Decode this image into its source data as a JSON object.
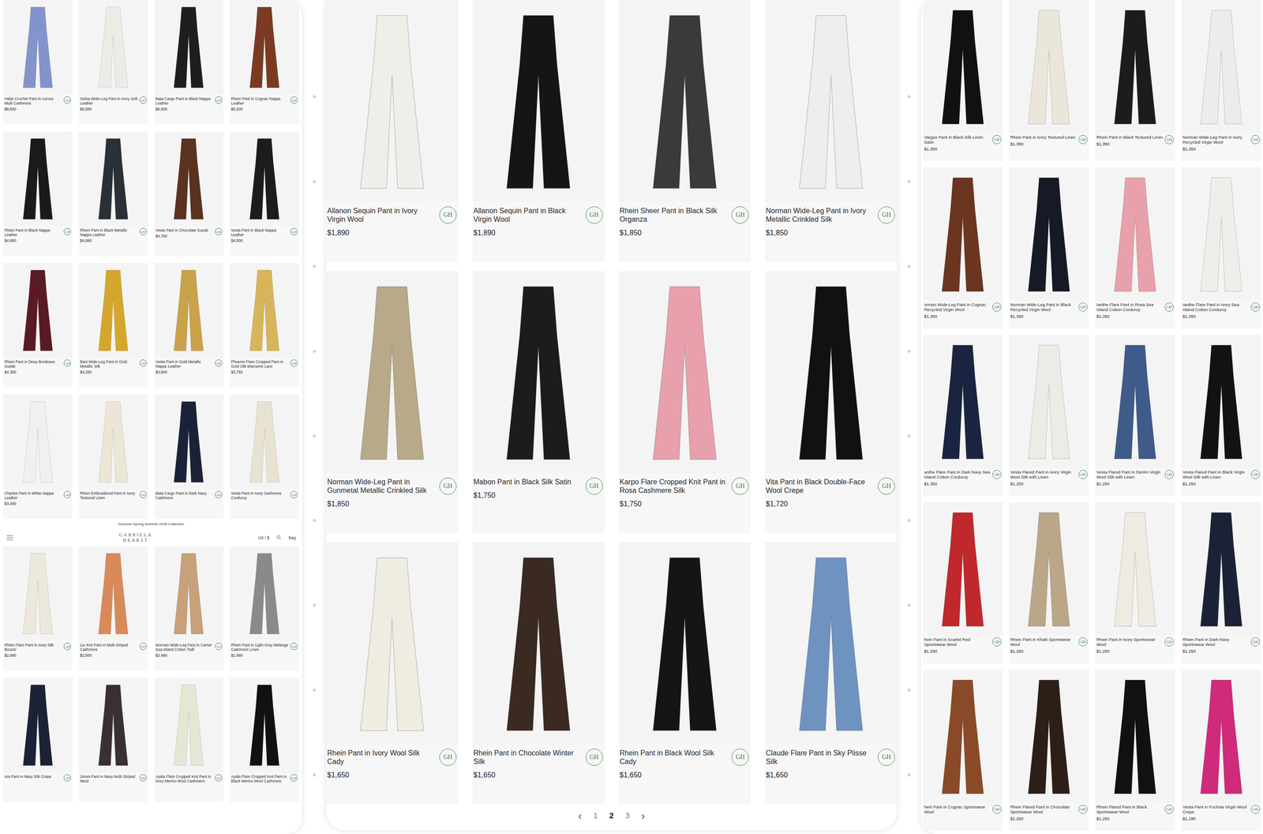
{
  "badge": "GH",
  "left_panel": {
    "products_top": [
      {
        "name": "Hebe Crochet Pant in Aurora Multi Cashmere",
        "price": "$8,600",
        "color": "#8394cc"
      },
      {
        "name": "Gelsa Wide-Leg Pant in Ivory Soft Leather",
        "price": "$6,990",
        "color": "#ecebe6"
      },
      {
        "name": "Bata Cargo Pant in Black Nappa Leather",
        "price": "$6,500",
        "color": "#1e1e1e"
      },
      {
        "name": "Rhein Pant in Cognac Nappa Leather",
        "price": "$5,200",
        "color": "#7a3b22"
      },
      {
        "name": "Rhein Pant in Black Nappa Leather",
        "price": "$4,990",
        "color": "#1a1a1a"
      },
      {
        "name": "Rhein Pant in Black Metallic Nappa Leather",
        "price": "$4,990",
        "color": "#2a3038"
      },
      {
        "name": "Vesta Pant in Chocolate Suede",
        "price": "$4,750",
        "color": "#5a3220"
      },
      {
        "name": "Vesta Pant in Black Nappa Leather",
        "price": "$4,500",
        "color": "#1c1c1c"
      },
      {
        "name": "Rhein Pant in Deep Bordeaux Suede",
        "price": "$4,350",
        "color": "#5a1a24"
      },
      {
        "name": "Bani Wide-Leg Pant in Gold Metallic Silk",
        "price": "$4,250",
        "color": "#d4a72c"
      },
      {
        "name": "Vesta Pant in Gold Metallic Nappa Leather",
        "price": "$3,900",
        "color": "#c9a24a"
      },
      {
        "name": "Phoenix Flare Cropped Pant in Gold Silk Macrame Lace",
        "price": "$3,750",
        "color": "#d8b45a"
      },
      {
        "name": "Charles Pant in White Nappa Leather",
        "price": "$3,490",
        "color": "#f0f0ee"
      },
      {
        "name": "Rhein Embroidered Pant in Ivory Textured Linen",
        "color": "#ece6d6"
      },
      {
        "name": "Bata Cargo Pant in Dark Navy Cashmere",
        "color": "#1b2238"
      },
      {
        "name": "Vesta Pant in Ivory Cashmere Corduroy",
        "color": "#e8e2d2"
      }
    ],
    "banner": "Discover Spring Summer 2026 Collection",
    "header": {
      "logo": "GABRIELA HEARST",
      "currency": "US / $",
      "bag": "Bag"
    },
    "products_bottom": [
      {
        "name": "Rhein Flare Pant in Ivory Silk Boucle",
        "price": "$2,990",
        "color": "#ece8dc"
      },
      {
        "name": "Liu Knit Pant in Multi Striped Cashmere",
        "price": "$2,500",
        "color": "#d98a5a"
      },
      {
        "name": "Norman Wide-Leg Pant in Camel Sea Island Cotton Twill",
        "price": "$2,490",
        "color": "#c8a07a"
      },
      {
        "name": "Rhein Pant in Light Grey Melange Cashmere Linen",
        "price": "$1,990",
        "color": "#8a8a8a"
      },
      {
        "name": "ura Pant in Navy Silk Crepe",
        "color": "#1c2236"
      },
      {
        "name": "Jones Pant in Navy Multi Striped Wool",
        "color": "#3a2f35"
      },
      {
        "name": "Ayala Flare Cropped Knit Pant in Ivory Merino Wool Cashmere",
        "color": "#e6e6d4"
      },
      {
        "name": "Ayala Flare Cropped Knit Pant in Black Merino Wool Cashmere",
        "color": "#111111"
      }
    ]
  },
  "middle_panel": {
    "products": [
      {
        "name": "Allanon Sequin Pant in Ivory Virgin Wool",
        "price": "$1,890",
        "color": "#efeee9"
      },
      {
        "name": "Allanon Sequin Pant in Black Virgin Wool",
        "price": "$1,890",
        "color": "#151515"
      },
      {
        "name": "Rhein Sheer Pant in Black Silk Organza",
        "price": "$1,850",
        "color": "#3a3a3a"
      },
      {
        "name": "Norman Wide-Leg Pant in Ivory Metallic Crinkled Silk",
        "price": "$1,850",
        "color": "#eeeeec"
      },
      {
        "name": "Norman Wide-Leg Pant in Gunmetal Metallic Crinkled Silk",
        "price": "$1,850",
        "color": "#b8aa88"
      },
      {
        "name": "Mabon Pant in Black Silk Satin",
        "price": "$1,750",
        "color": "#1c1c1c"
      },
      {
        "name": "Karpo Flare Cropped Knit Pant in Rosa Cashmere Silk",
        "price": "$1,750",
        "color": "#e8a0ac"
      },
      {
        "name": "Vita Pant in Black Double-Face Wool Crepe",
        "price": "$1,720",
        "color": "#111111"
      },
      {
        "name": "Rhein Pant in Ivory Wool Silk Cady",
        "price": "$1,650",
        "color": "#efece2"
      },
      {
        "name": "Rhein Pant in Chocolate Winter Silk",
        "price": "$1,650",
        "color": "#3a2a22"
      },
      {
        "name": "Rhein Pant in Black Wool Silk Cady",
        "price": "$1,650",
        "color": "#151515"
      },
      {
        "name": "Claude Flare Pant in Sky Plisse Silk",
        "price": "$1,650",
        "color": "#6f93c0"
      }
    ],
    "pagination": {
      "prev": "‹",
      "next": "›",
      "pages": [
        {
          "label": "1",
          "selected": false
        },
        {
          "label": "2",
          "selected": true
        },
        {
          "label": "3",
          "selected": false
        }
      ]
    }
  },
  "right_panel": {
    "products": [
      {
        "name": "Vargas Pant in Black Silk Linen Satin",
        "price": "$1,350",
        "color": "#111111"
      },
      {
        "name": "Rhein Pant in Ivory Textured Linen",
        "price": "$1,350",
        "color": "#ebe6da"
      },
      {
        "name": "Rhein Pant in Black Textured Linen",
        "price": "$1,350",
        "color": "#1c1c1c"
      },
      {
        "name": "Norman Wide-Leg Pant in Ivory Recycled Virgin Wool",
        "price": "$1,350",
        "color": "#ececec"
      },
      {
        "name": "orman Wide-Leg Pant in Cognac Recycled Virgin Wool",
        "price": "$1,350",
        "color": "#6b3520"
      },
      {
        "name": "Norman Wide-Leg Pant in Black Recycled Virgin Wool",
        "price": "$1,350",
        "color": "#151a26"
      },
      {
        "name": "Ianthe Flare Pant in Rosa Sea Island Cotton Corduroy",
        "price": "$1,350",
        "color": "#e8a0aa"
      },
      {
        "name": "Ianthe Flare Pant in Ivory Sea Island Cotton Corduroy",
        "price": "$1,350",
        "color": "#eeeeea"
      },
      {
        "name": "anthe Flare Pant in Dark Navy Sea Island Cotton Corduroy",
        "price": "$1,350",
        "color": "#1a2440"
      },
      {
        "name": "Vesta Flared Pant in Ivory Virgin Wool Silk with Linen",
        "price": "$1,250",
        "color": "#ecebe5"
      },
      {
        "name": "Vesta Flared Pant in Denim Virgin Wool Silk with Linen",
        "price": "$1,250",
        "color": "#3f5b8a"
      },
      {
        "name": "Vesta Flared Pant in Black Virgin Wool Silk with Linen",
        "price": "$1,250",
        "color": "#121212"
      },
      {
        "name": "hein Pant in Scarlet Red Sportswear Wool",
        "price": "$1,250",
        "color": "#c0282c"
      },
      {
        "name": "Rhein Pant in Khaki Sportswear Wool",
        "price": "$1,250",
        "color": "#bba688"
      },
      {
        "name": "Rhein Pant in Ivory Sportswear Wool",
        "price": "$1,250",
        "color": "#eeebe3"
      },
      {
        "name": "Rhein Pant in Dark Navy Sportswear Wool",
        "price": "$1,250",
        "color": "#1c2236"
      },
      {
        "name": "hein Pant in Cognac Sportswear Wool",
        "color": "#8a4a28"
      },
      {
        "name": "Rhein Flared Pant in Chocolate Sportswear Wool",
        "price": "$1,250",
        "color": "#2e1e18"
      },
      {
        "name": "Rhein Flared Pant in Black Sportswear Wool",
        "price": "$1,250",
        "color": "#111111"
      },
      {
        "name": "Vesta Pant in Fuchsia Virgin Wool Crepe",
        "price": "$1,190",
        "color": "#d02a7a"
      }
    ]
  }
}
